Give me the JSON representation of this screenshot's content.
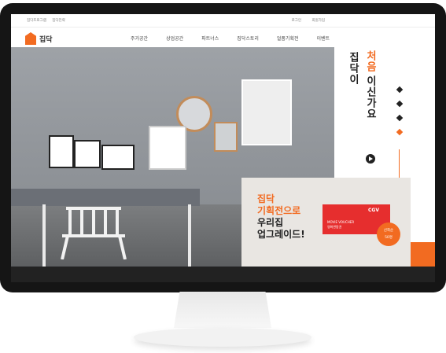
{
  "topbar": {
    "left": [
      "집닥프로그램",
      "집닥전략"
    ],
    "right": [
      "로그인",
      "회원가입"
    ]
  },
  "brand": {
    "name": "집닥",
    "accent": "#f26b21"
  },
  "nav": {
    "items": [
      "주거공간",
      "상업공간",
      "파트너스",
      "집닥스토리",
      "얼품기획전",
      "이벤트"
    ]
  },
  "hero": {
    "tagline_black": "집닥이",
    "tagline_orange": "처음",
    "tagline_black2": "이신가요"
  },
  "promo": {
    "line1": "집닥",
    "line2": "기획전으로",
    "line3": "우리집",
    "line4": "업그레이드!",
    "voucher_logo": "CGV",
    "voucher_line1": "MOVIE VOUCHER",
    "voucher_line2": "영화관람권",
    "badge_line1": "선착순",
    "badge_line2": "50명"
  }
}
